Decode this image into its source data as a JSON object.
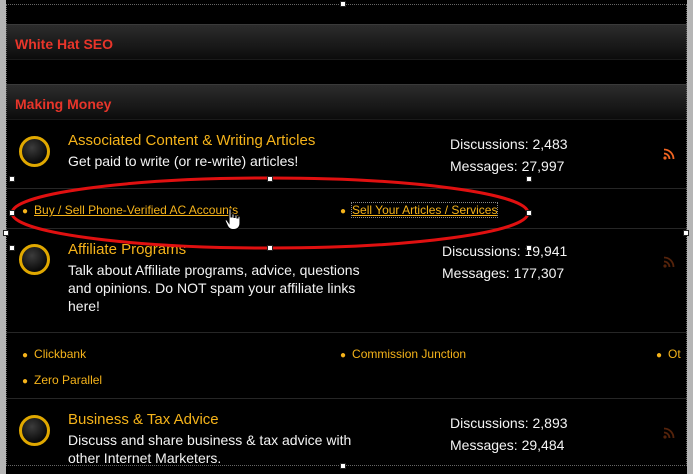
{
  "categories": [
    {
      "title": "White Hat SEO"
    },
    {
      "title": "Making Money"
    }
  ],
  "forums": [
    {
      "title": "Associated Content & Writing Articles",
      "desc": "Get paid to write (or re-write) articles!",
      "discussions_label": "Discussions:",
      "discussions": "2,483",
      "messages_label": "Messages:",
      "messages": "27,997",
      "subforums": [
        "Buy / Sell Phone-Verified AC Accounts",
        "Sell Your Articles / Services"
      ]
    },
    {
      "title": "Affiliate Programs",
      "desc": "Talk about Affiliate programs, advice, questions and opinions. Do NOT spam your affiliate links here!",
      "discussions_label": "Discussions:",
      "discussions": "19,941",
      "messages_label": "Messages:",
      "messages": "177,307",
      "subforums": [
        "Clickbank",
        "Commission Junction",
        "Ot",
        "Zero Parallel"
      ]
    },
    {
      "title": "Business & Tax Advice",
      "desc": "Discuss and share business & tax advice with other Internet Marketers.",
      "discussions_label": "Discussions:",
      "discussions": "2,893",
      "messages_label": "Messages:",
      "messages": "29,484",
      "subforums": []
    }
  ],
  "colors": {
    "category_text": "#e8352a",
    "forum_title": "#f5b31a",
    "annotation": "#e01010",
    "rss": "#f26522"
  },
  "icons": [
    "forum-node-icon",
    "rss-feed-icon",
    "hand-pointer-cursor-icon"
  ]
}
